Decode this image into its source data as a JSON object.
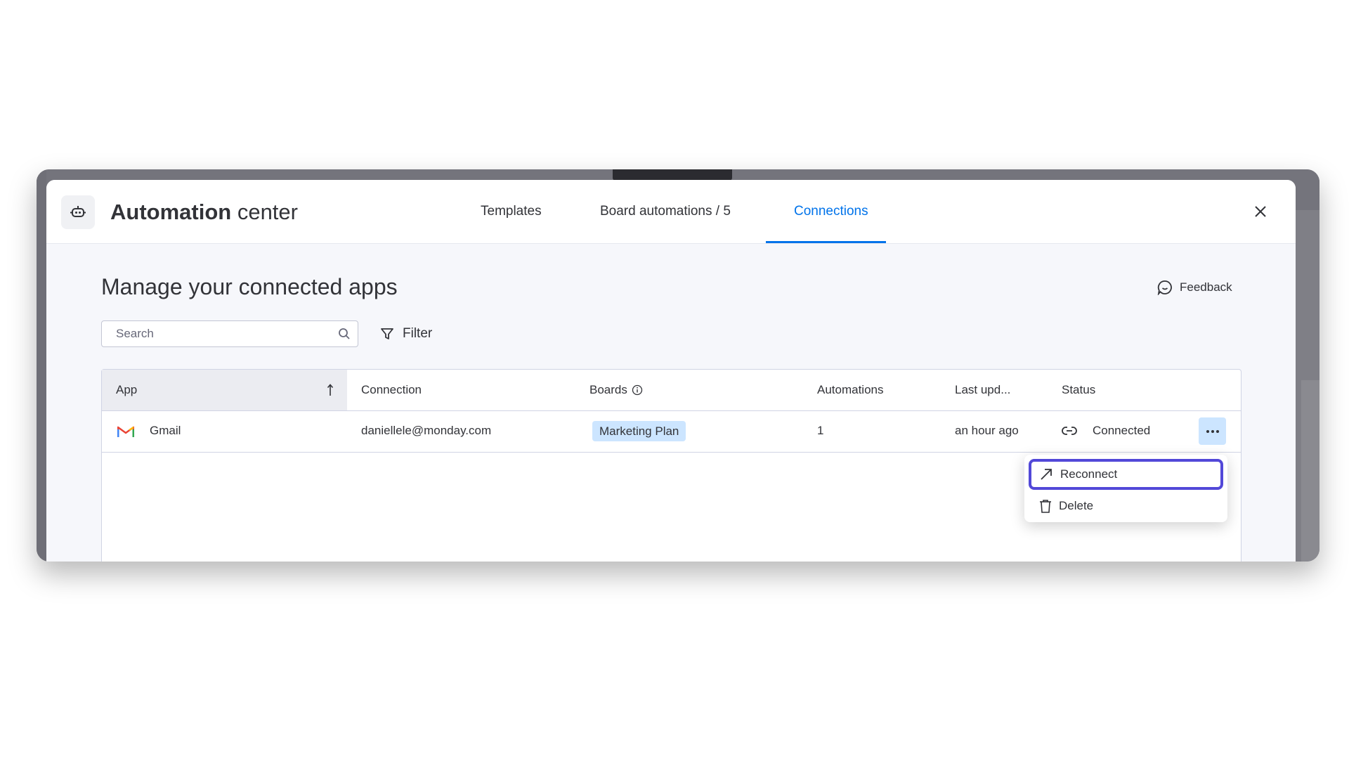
{
  "background": {
    "board_name": "Marketing Plan"
  },
  "modal": {
    "title_bold": "Automation",
    "title_light": "center",
    "tabs": [
      {
        "label": "Templates",
        "active": false
      },
      {
        "label": "Board automations / 5",
        "active": false
      },
      {
        "label": "Connections",
        "active": true
      }
    ],
    "close_icon": "close-icon",
    "accent_color": "#0073ea"
  },
  "content": {
    "heading": "Manage your connected apps",
    "feedback_label": "Feedback",
    "search": {
      "placeholder": "Search",
      "value": ""
    },
    "filter_label": "Filter"
  },
  "table": {
    "columns": [
      "App",
      "Connection",
      "Boards",
      "Automations",
      "Last upd...",
      "Status"
    ],
    "sort_column": "App",
    "rows": [
      {
        "app": "Gmail",
        "connection": "daniellele@monday.com",
        "board": "Marketing Plan",
        "automations": "1",
        "last_updated": "an hour ago",
        "status": "Connected"
      }
    ]
  },
  "menu": {
    "items": [
      {
        "label": "Reconnect",
        "icon": "arrow-up-right-icon",
        "focused": true
      },
      {
        "label": "Delete",
        "icon": "trash-icon",
        "focused": false
      }
    ],
    "focus_color": "#5248d8"
  }
}
